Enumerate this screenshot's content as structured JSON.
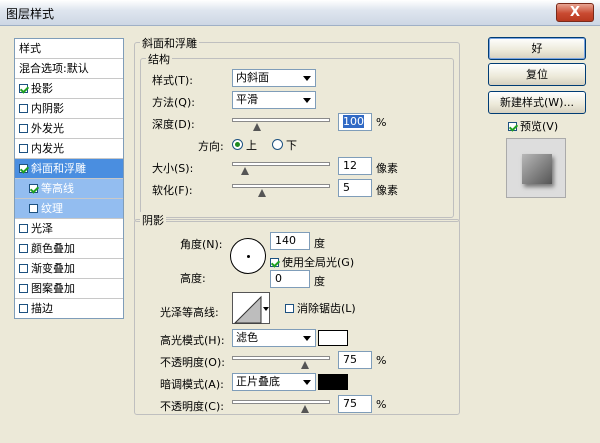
{
  "window": {
    "title": "图层样式",
    "close_label": "X"
  },
  "style_list": {
    "header": "样式",
    "blend_options": "混合选项:默认",
    "items": [
      {
        "label": "投影",
        "checked": true
      },
      {
        "label": "内阴影",
        "checked": false
      },
      {
        "label": "外发光",
        "checked": false
      },
      {
        "label": "内发光",
        "checked": false
      },
      {
        "label": "斜面和浮雕",
        "checked": true
      },
      {
        "label": "等高线",
        "checked": true
      },
      {
        "label": "纹理",
        "checked": false
      },
      {
        "label": "光泽",
        "checked": false
      },
      {
        "label": "颜色叠加",
        "checked": false
      },
      {
        "label": "渐变叠加",
        "checked": false
      },
      {
        "label": "图案叠加",
        "checked": false
      },
      {
        "label": "描边",
        "checked": false
      }
    ]
  },
  "bevel": {
    "section_title": "斜面和浮雕",
    "structure_title": "结构",
    "style_label": "样式(T):",
    "style_value": "内斜面",
    "technique_label": "方法(Q):",
    "technique_value": "平滑",
    "depth_label": "深度(D):",
    "depth_value": "100",
    "depth_unit": "%",
    "direction_label": "方向:",
    "direction_up": "上",
    "direction_down": "下",
    "size_label": "大小(S):",
    "size_value": "12",
    "size_unit": "像素",
    "soften_label": "软化(F):",
    "soften_value": "5",
    "soften_unit": "像素"
  },
  "shading": {
    "title": "阴影",
    "angle_label": "角度(N):",
    "angle_value": "140",
    "angle_unit": "度",
    "global_light_label": "使用全局光(G)",
    "altitude_label": "高度:",
    "altitude_value": "0",
    "altitude_unit": "度",
    "gloss_label": "光泽等高线:",
    "antialias_label": "消除锯齿(L)",
    "highlight_mode_label": "高光模式(H):",
    "highlight_mode_value": "滤色",
    "highlight_color": "#ffffff",
    "highlight_opacity_label": "不透明度(O):",
    "highlight_opacity_value": "75",
    "shadow_mode_label": "暗调模式(A):",
    "shadow_mode_value": "正片叠底",
    "shadow_color": "#000000",
    "shadow_opacity_label": "不透明度(C):",
    "shadow_opacity_value": "75",
    "percent": "%"
  },
  "buttons": {
    "ok": "好",
    "reset": "复位",
    "new_style": "新建样式(W)...",
    "preview": "预览(V)"
  }
}
